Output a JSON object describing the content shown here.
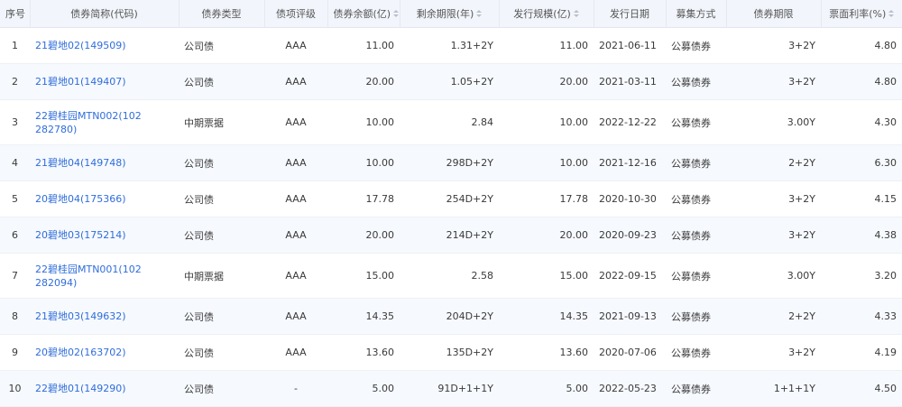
{
  "columns": {
    "seq": "序号",
    "name": "债券简称(代码)",
    "type": "债券类型",
    "rating": "债项评级",
    "balance": "债券余额(亿)",
    "remaining": "剩余期限(年)",
    "issue_size": "发行规模(亿)",
    "issue_date": "发行日期",
    "method": "募集方式",
    "term": "债券期限",
    "coupon": "票面利率(%)"
  },
  "rows": [
    {
      "seq": "1",
      "name": "21碧地02(149509)",
      "type": "公司债",
      "rating": "AAA",
      "balance": "11.00",
      "remaining": "1.31+2Y",
      "issue_size": "11.00",
      "issue_date": "2021-06-11",
      "method": "公募债券",
      "term": "3+2Y",
      "coupon": "4.80"
    },
    {
      "seq": "2",
      "name": "21碧地01(149407)",
      "type": "公司债",
      "rating": "AAA",
      "balance": "20.00",
      "remaining": "1.05+2Y",
      "issue_size": "20.00",
      "issue_date": "2021-03-11",
      "method": "公募债券",
      "term": "3+2Y",
      "coupon": "4.80"
    },
    {
      "seq": "3",
      "name": "22碧桂园MTN002(102282780)",
      "type": "中期票据",
      "rating": "AAA",
      "balance": "10.00",
      "remaining": "2.84",
      "issue_size": "10.00",
      "issue_date": "2022-12-22",
      "method": "公募债券",
      "term": "3.00Y",
      "coupon": "4.30"
    },
    {
      "seq": "4",
      "name": "21碧地04(149748)",
      "type": "公司债",
      "rating": "AAA",
      "balance": "10.00",
      "remaining": "298D+2Y",
      "issue_size": "10.00",
      "issue_date": "2021-12-16",
      "method": "公募债券",
      "term": "2+2Y",
      "coupon": "6.30"
    },
    {
      "seq": "5",
      "name": "20碧地04(175366)",
      "type": "公司债",
      "rating": "AAA",
      "balance": "17.78",
      "remaining": "254D+2Y",
      "issue_size": "17.78",
      "issue_date": "2020-10-30",
      "method": "公募债券",
      "term": "3+2Y",
      "coupon": "4.15"
    },
    {
      "seq": "6",
      "name": "20碧地03(175214)",
      "type": "公司债",
      "rating": "AAA",
      "balance": "20.00",
      "remaining": "214D+2Y",
      "issue_size": "20.00",
      "issue_date": "2020-09-23",
      "method": "公募债券",
      "term": "3+2Y",
      "coupon": "4.38"
    },
    {
      "seq": "7",
      "name": "22碧桂园MTN001(102282094)",
      "type": "中期票据",
      "rating": "AAA",
      "balance": "15.00",
      "remaining": "2.58",
      "issue_size": "15.00",
      "issue_date": "2022-09-15",
      "method": "公募债券",
      "term": "3.00Y",
      "coupon": "3.20"
    },
    {
      "seq": "8",
      "name": "21碧地03(149632)",
      "type": "公司债",
      "rating": "AAA",
      "balance": "14.35",
      "remaining": "204D+2Y",
      "issue_size": "14.35",
      "issue_date": "2021-09-13",
      "method": "公募债券",
      "term": "2+2Y",
      "coupon": "4.33"
    },
    {
      "seq": "9",
      "name": "20碧地02(163702)",
      "type": "公司债",
      "rating": "AAA",
      "balance": "13.60",
      "remaining": "135D+2Y",
      "issue_size": "13.60",
      "issue_date": "2020-07-06",
      "method": "公募债券",
      "term": "3+2Y",
      "coupon": "4.19"
    },
    {
      "seq": "10",
      "name": "22碧地01(149290)",
      "type": "公司债",
      "rating": "-",
      "balance": "5.00",
      "remaining": "91D+1+1Y",
      "issue_size": "5.00",
      "issue_date": "2022-05-23",
      "method": "公募债券",
      "term": "1+1+1Y",
      "coupon": "4.50"
    }
  ]
}
